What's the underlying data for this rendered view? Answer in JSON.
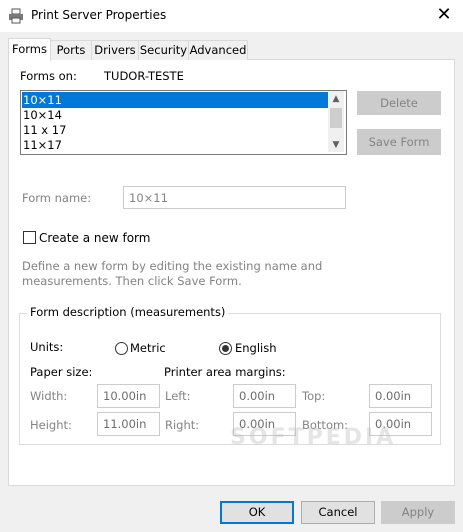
{
  "window": {
    "title": "Print Server Properties",
    "close_glyph": "✕"
  },
  "tabs": [
    {
      "label": "Forms"
    },
    {
      "label": "Ports"
    },
    {
      "label": "Drivers"
    },
    {
      "label": "Security"
    },
    {
      "label": "Advanced"
    }
  ],
  "forms": {
    "forms_on_label": "Forms on:",
    "server_name": "TUDOR-TESTE",
    "list_items": [
      "10×11",
      "10×14",
      "11 x 17",
      "11×17"
    ],
    "selected_index": 0,
    "delete_label": "Delete",
    "save_form_label": "Save Form",
    "form_name_label": "Form name:",
    "form_name_value": "10×11",
    "create_new_label": "Create a new form",
    "help_text_line1": "Define a new form by editing the existing name and",
    "help_text_line2": "measurements. Then click Save Form."
  },
  "description": {
    "group_title": "Form description (measurements)",
    "units_label": "Units:",
    "metric_label": "Metric",
    "english_label": "English",
    "selected_unit": "English",
    "paper_size_label": "Paper size:",
    "printer_margins_label": "Printer area margins:",
    "width_label": "Width:",
    "width_value": "10.00in",
    "height_label": "Height:",
    "height_value": "11.00in",
    "left_label": "Left:",
    "left_value": "0.00in",
    "right_label": "Right:",
    "right_value": "0.00in",
    "top_label": "Top:",
    "top_value": "0.00in",
    "bottom_label": "Bottom:",
    "bottom_value": "0.00in"
  },
  "footer": {
    "ok_label": "OK",
    "cancel_label": "Cancel",
    "apply_label": "Apply"
  },
  "watermark": "SOFTPEDIA",
  "colors": {
    "selection": "#0078d7",
    "dialog_bg": "#f0f0f0",
    "disabled_text": "#838383"
  }
}
